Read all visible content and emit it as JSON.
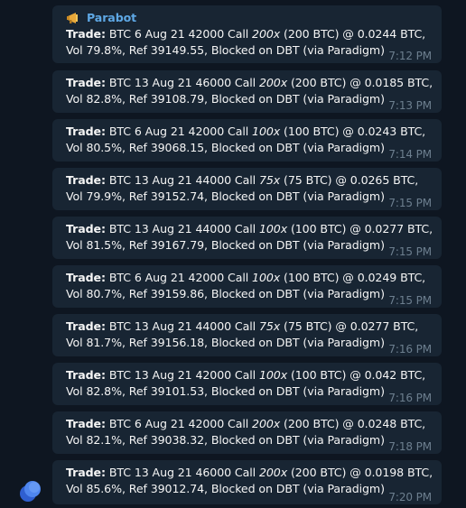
{
  "chat": {
    "sender_name": "Parabot",
    "sender_icon": "megaphone-icon",
    "accent_color": "#5ea8e5",
    "bubble_color": "#182533",
    "messages": [
      {
        "label": "Trade:",
        "pre": "BTC 6 Aug 21 42000 Call",
        "mult": "200x",
        "post": "(200 BTC) @ 0.0244 BTC, Vol 79.8%, Ref 39149.55, Blocked on DBT (via Paradigm)",
        "time": "7:12 PM"
      },
      {
        "label": "Trade:",
        "pre": "BTC 13 Aug 21 46000 Call",
        "mult": "200x",
        "post": "(200 BTC) @ 0.0185 BTC, Vol 82.8%, Ref 39108.79, Blocked on DBT (via Paradigm)",
        "time": "7:13 PM"
      },
      {
        "label": "Trade:",
        "pre": "BTC 6 Aug 21 42000 Call",
        "mult": "100x",
        "post": "(100 BTC) @ 0.0243 BTC, Vol 80.5%, Ref 39068.15, Blocked on DBT (via Paradigm)",
        "time": "7:14 PM"
      },
      {
        "label": "Trade:",
        "pre": "BTC 13 Aug 21 44000 Call",
        "mult": "75x",
        "post": "(75 BTC) @ 0.0265 BTC, Vol 79.9%, Ref 39152.74, Blocked on DBT (via Paradigm)",
        "time": "7:15 PM"
      },
      {
        "label": "Trade:",
        "pre": "BTC 13 Aug 21 44000 Call",
        "mult": "100x",
        "post": "(100 BTC) @ 0.0277 BTC, Vol 81.5%, Ref 39167.79, Blocked on DBT (via Paradigm)",
        "time": "7:15 PM"
      },
      {
        "label": "Trade:",
        "pre": "BTC 6 Aug 21 42000 Call",
        "mult": "100x",
        "post": "(100 BTC) @ 0.0249 BTC, Vol 80.7%, Ref 39159.86, Blocked on DBT (via Paradigm)",
        "time": "7:15 PM"
      },
      {
        "label": "Trade:",
        "pre": "BTC 13 Aug 21 44000 Call",
        "mult": "75x",
        "post": "(75 BTC) @ 0.0277 BTC, Vol 81.7%, Ref 39156.18, Blocked on DBT (via Paradigm)",
        "time": "7:16 PM"
      },
      {
        "label": "Trade:",
        "pre": "BTC 13 Aug 21 42000 Call",
        "mult": "100x",
        "post": "(100 BTC) @ 0.042 BTC, Vol 82.8%, Ref 39101.53, Blocked on DBT (via Paradigm)",
        "time": "7:16 PM"
      },
      {
        "label": "Trade:",
        "pre": "BTC 6 Aug 21 42000 Call",
        "mult": "200x",
        "post": "(200 BTC) @ 0.0248 BTC, Vol 82.1%, Ref 39038.32, Blocked on DBT (via Paradigm)",
        "time": "7:18 PM"
      },
      {
        "label": "Trade:",
        "pre": "BTC 13 Aug 21 46000 Call",
        "mult": "200x",
        "post": "(200 BTC) @ 0.0198 BTC, Vol 85.6%, Ref 39012.74, Blocked on DBT (via Paradigm)",
        "time": "7:20 PM"
      }
    ]
  }
}
